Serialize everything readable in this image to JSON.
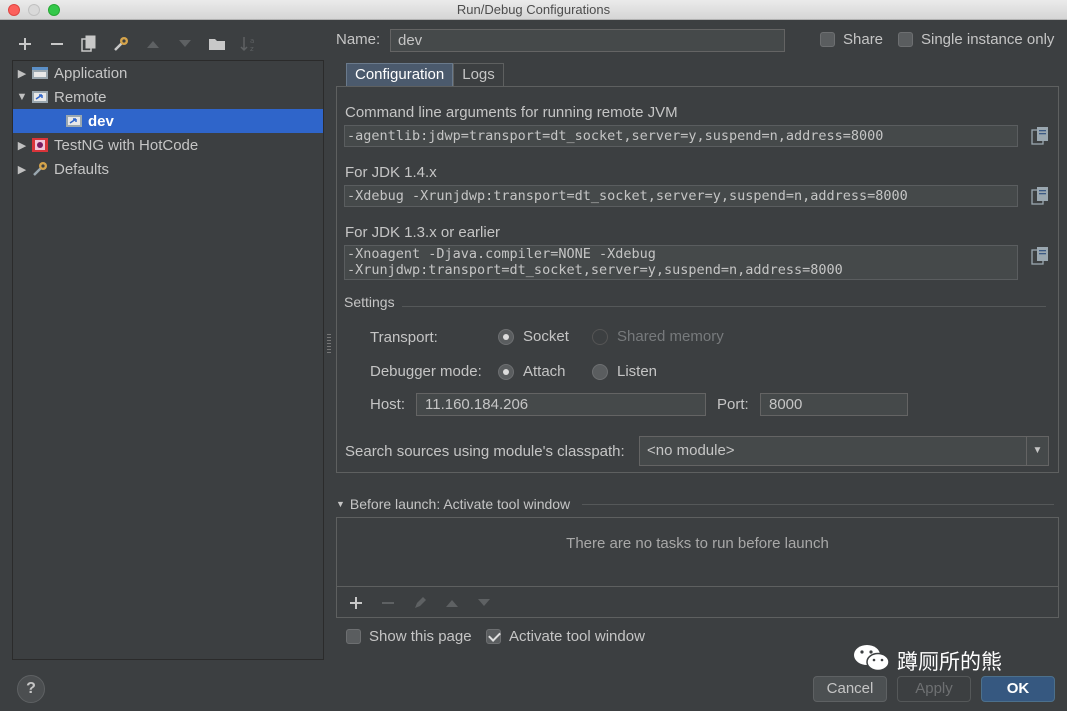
{
  "window": {
    "title": "Run/Debug Configurations"
  },
  "toolbar": {
    "icons": [
      "add-icon",
      "remove-icon",
      "copy-icon",
      "wrench-icon",
      "move-up-icon",
      "move-down-icon",
      "folder-icon",
      "sort-icon"
    ]
  },
  "tree": {
    "items": [
      {
        "label": "Application",
        "icon": "application-icon",
        "expanded": false
      },
      {
        "label": "Remote",
        "icon": "remote-icon",
        "expanded": true
      },
      {
        "label": "dev",
        "icon": "remote-icon",
        "selected": true
      },
      {
        "label": "TestNG with HotCode",
        "icon": "testng-icon",
        "expanded": false
      },
      {
        "label": "Defaults",
        "icon": "wrench-icon",
        "expanded": false
      }
    ]
  },
  "header": {
    "name_label": "Name:",
    "name_value": "dev",
    "share_label": "Share",
    "share_checked": false,
    "single_instance_label": "Single instance only",
    "single_instance_checked": false
  },
  "tabs": [
    {
      "label": "Configuration",
      "active": true
    },
    {
      "label": "Logs",
      "active": false
    }
  ],
  "config": {
    "cmd_label": "Command line arguments for running remote JVM",
    "cmd_value": "-agentlib:jdwp=transport=dt_socket,server=y,suspend=n,address=8000",
    "jdk14_label": "For JDK 1.4.x",
    "jdk14_value": "-Xdebug -Xrunjdwp:transport=dt_socket,server=y,suspend=n,address=8000",
    "jdk13_label": "For JDK 1.3.x or earlier",
    "jdk13_line1": "-Xnoagent -Djava.compiler=NONE -Xdebug",
    "jdk13_line2": "-Xrunjdwp:transport=dt_socket,server=y,suspend=n,address=8000",
    "settings_label": "Settings",
    "transport_label": "Transport:",
    "transport_socket": "Socket",
    "transport_shared": "Shared memory",
    "debugger_label": "Debugger mode:",
    "debugger_attach": "Attach",
    "debugger_listen": "Listen",
    "host_label": "Host:",
    "host_value": "11.160.184.206",
    "port_label": "Port:",
    "port_value": "8000",
    "classpath_label": "Search sources using module's classpath:",
    "classpath_value": "<no module>"
  },
  "before_launch": {
    "title": "Before launch: Activate tool window",
    "empty_text": "There are no tasks to run before launch"
  },
  "footer": {
    "show_page_label": "Show this page",
    "show_page_checked": false,
    "activate_label": "Activate tool window",
    "activate_checked": true,
    "cancel": "Cancel",
    "apply": "Apply",
    "ok": "OK",
    "help": "?",
    "watermark": "蹲厕所的熊"
  },
  "colors": {
    "selection": "#2f65ca",
    "ok_button": "#365880",
    "background": "#3c3f41"
  }
}
